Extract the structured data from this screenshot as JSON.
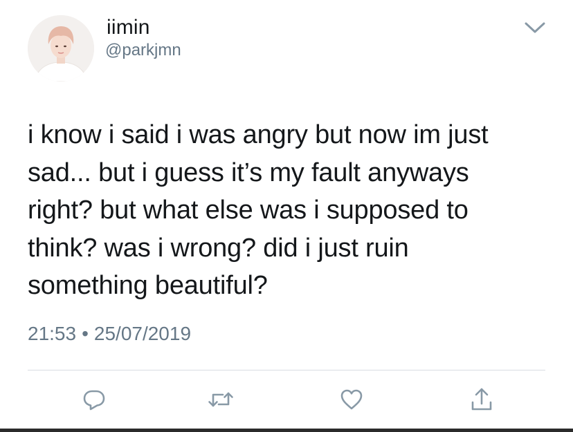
{
  "user": {
    "display_name": "iimin",
    "handle": "@parkjmn",
    "avatar_icon": "profile-photo"
  },
  "tweet": {
    "text": "i know i said i was angry but now im just\nsad... but i guess it’s my fault anyways\nright? but what else was i supposed to\nthink? was i wrong? did i just ruin\nsomething beautiful?",
    "time": "21:53",
    "separator": "•",
    "date": "25/07/2019"
  },
  "actions": [
    {
      "name": "reply",
      "icon": "reply-icon"
    },
    {
      "name": "retweet",
      "icon": "retweet-icon"
    },
    {
      "name": "like",
      "icon": "heart-icon"
    },
    {
      "name": "share",
      "icon": "share-icon"
    }
  ],
  "colors": {
    "text": "#14171a",
    "secondary": "#657786",
    "icon": "#8899a6",
    "divider": "#d8dde2"
  }
}
